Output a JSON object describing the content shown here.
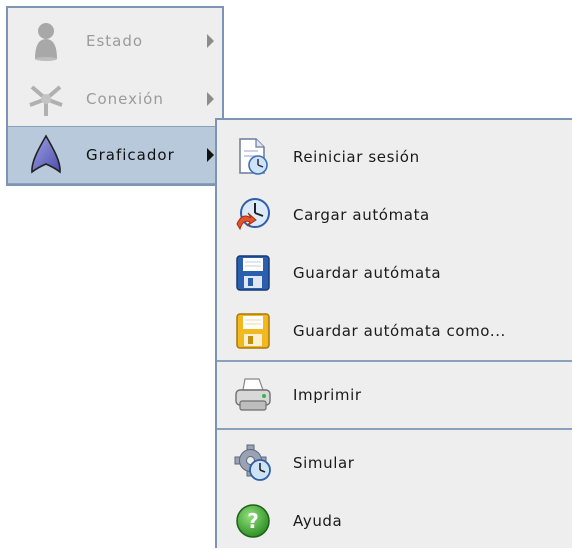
{
  "main_menu": {
    "items": [
      {
        "label": "Estado",
        "icon": "person-icon",
        "enabled": false
      },
      {
        "label": "Conexión",
        "icon": "connection-icon",
        "enabled": false
      },
      {
        "label": "Graficador",
        "icon": "graph-icon",
        "enabled": true,
        "selected": true
      }
    ]
  },
  "sub_menu": {
    "items": [
      {
        "label": "Reiniciar sesión",
        "icon": "restart-document-icon"
      },
      {
        "label": "Cargar autómata",
        "icon": "load-clock-icon"
      },
      {
        "label": "Guardar autómata",
        "icon": "save-floppy-icon"
      },
      {
        "label": "Guardar autómata como...",
        "icon": "save-as-floppy-icon"
      },
      {
        "label": "Imprimir",
        "icon": "printer-icon"
      },
      {
        "label": "Simular",
        "icon": "gear-clock-icon"
      },
      {
        "label": "Ayuda",
        "icon": "help-icon"
      }
    ]
  },
  "colors": {
    "menu_bg": "#eeeeee",
    "border": "#7e94b4",
    "selected_bg": "#b9c9dc",
    "disabled_text": "#9b9b9b",
    "floppy_blue": "#2a5fb0",
    "floppy_yellow": "#f2b820",
    "help_green": "#3aa62f"
  }
}
